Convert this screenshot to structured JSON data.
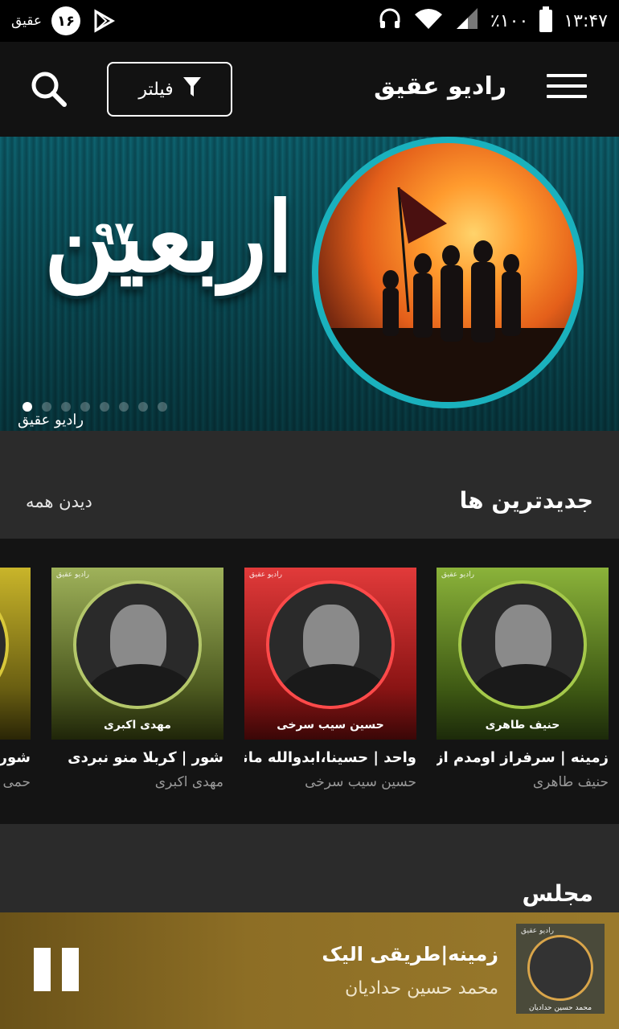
{
  "status_bar": {
    "app_logo": "عقیق",
    "notification_count": "۱۶",
    "battery": "٪۱۰۰",
    "time": "۱۳:۴۷"
  },
  "app_bar": {
    "title": "رادیو عقیق",
    "filter_label": "فیلتر"
  },
  "banner": {
    "title": "اربعین",
    "badge": "۹۷",
    "logo": "رادیو عقیق",
    "slides": 8,
    "active_slide": 1
  },
  "newest": {
    "title": "جدیدترین ها",
    "see_all": "دیدن همه",
    "items": [
      {
        "title": "زمینه | سرفراز اومدم از سف..",
        "artist": "حنیف طاهری",
        "art_name": "حنیف طاهری",
        "color": "#7fa334"
      },
      {
        "title": "واحد | حسینا،ابدوالله مانن..",
        "artist": "حسین سیب سرخی",
        "art_name": "حسین سیب سرخی",
        "color": "#d0282c"
      },
      {
        "title": "شور | کربلا منو نبردی",
        "artist": "مهدی اکبری",
        "art_name": "مهدی اکبری",
        "color": "#9aa85a"
      },
      {
        "title": "شور",
        "artist": "حمی",
        "art_name": "",
        "color": "#b7a522"
      }
    ]
  },
  "majles": {
    "title": "مجلس"
  },
  "player": {
    "title": "زمینه|طریقی الیک",
    "artist": "محمد حسین حدادیان",
    "art_name": "محمد حسین حدادیان"
  }
}
